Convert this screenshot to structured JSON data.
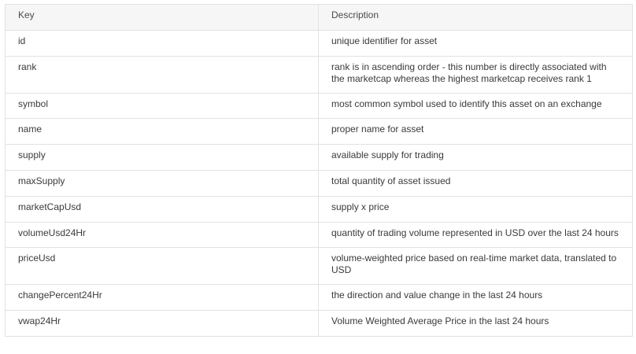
{
  "table": {
    "headers": [
      "Key",
      "Description"
    ],
    "rows": [
      {
        "key": "id",
        "description": "unique identifier for asset"
      },
      {
        "key": "rank",
        "description": "rank is in ascending order - this number is directly associated with the marketcap whereas the highest marketcap receives rank 1"
      },
      {
        "key": "symbol",
        "description": "most common symbol used to identify this asset on an exchange"
      },
      {
        "key": "name",
        "description": "proper name for asset"
      },
      {
        "key": "supply",
        "description": "available supply for trading"
      },
      {
        "key": "maxSupply",
        "description": "total quantity of asset issued"
      },
      {
        "key": "marketCapUsd",
        "description": "supply x price"
      },
      {
        "key": "volumeUsd24Hr",
        "description": "quantity of trading volume represented in USD over the last 24 hours"
      },
      {
        "key": "priceUsd",
        "description": "volume-weighted price based on real-time market data, translated to USD"
      },
      {
        "key": "changePercent24Hr",
        "description": "the direction and value change in the last 24 hours"
      },
      {
        "key": "vwap24Hr",
        "description": "Volume Weighted Average Price in the last 24 hours"
      }
    ]
  }
}
